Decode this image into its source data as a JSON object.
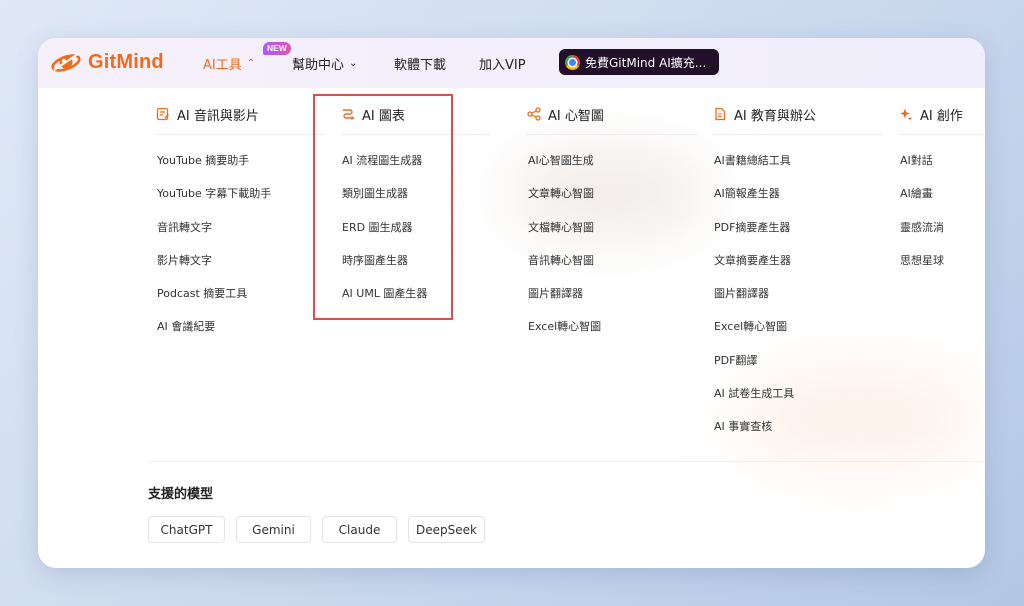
{
  "brand": {
    "name": "GitMind",
    "accent": "#f26a1b"
  },
  "nav": {
    "ai_tools": "AI工具",
    "new_badge": "NEW",
    "help_center": "幫助中心",
    "download": "軟體下載",
    "vip": "加入VIP",
    "extension": "免費GitMind AI擴充..."
  },
  "columns": [
    {
      "title": "AI 音訊與影片",
      "icon": "edit-doc-icon",
      "items": [
        "YouTube 摘要助手",
        "YouTube 字幕下載助手",
        "音訊轉文字",
        "影片轉文字",
        "Podcast 摘要工具",
        "AI 會議紀要"
      ]
    },
    {
      "title": "AI 圖表",
      "icon": "flow-icon",
      "items": [
        "AI 流程圖生成器",
        "類別圖生成器",
        "ERD 圖生成器",
        "時序圖產生器",
        "AI UML 圖產生器"
      ]
    },
    {
      "title": "AI 心智圖",
      "icon": "share-nodes-icon",
      "items": [
        "AI心智圖生成",
        "文章轉心智圖",
        "文檔轉心智圖",
        "音訊轉心智圖",
        "圖片翻譯器",
        "Excel轉心智圖"
      ]
    },
    {
      "title": "AI 教育與辦公",
      "icon": "document-icon",
      "items": [
        "AI書籍總結工具",
        "AI簡報產生器",
        "PDF摘要產生器",
        "文章摘要產生器",
        "圖片翻譯器",
        "Excel轉心智圖",
        "PDF翻譯",
        "AI 試卷生成工具",
        "AI 事實查核"
      ]
    },
    {
      "title": "AI 創作",
      "icon": "sparkle-icon",
      "items": [
        "AI對話",
        "AI繪畫",
        "靈感流淌",
        "思想星球"
      ]
    }
  ],
  "models": {
    "title": "支援的模型",
    "items": [
      "ChatGPT",
      "Gemini",
      "Claude",
      "DeepSeek"
    ]
  }
}
